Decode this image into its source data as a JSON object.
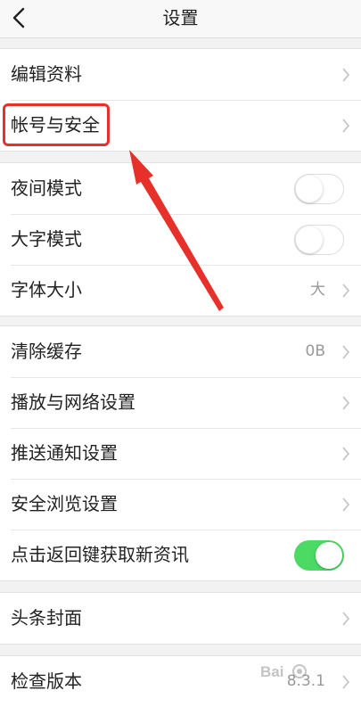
{
  "header": {
    "title": "设置",
    "back_icon": "chevron-left-icon"
  },
  "groups": [
    {
      "rows": [
        {
          "label": "编辑资料",
          "accessory": "chevron"
        },
        {
          "label": "帐号与安全",
          "accessory": "chevron",
          "highlighted": true
        }
      ]
    },
    {
      "rows": [
        {
          "label": "夜间模式",
          "accessory": "toggle",
          "toggle_on": false
        },
        {
          "label": "大字模式",
          "accessory": "toggle",
          "toggle_on": false
        },
        {
          "label": "字体大小",
          "accessory": "chevron",
          "value": "大"
        }
      ]
    },
    {
      "rows": [
        {
          "label": "清除缓存",
          "accessory": "chevron",
          "value": "0B"
        },
        {
          "label": "播放与网络设置",
          "accessory": "chevron"
        },
        {
          "label": "推送通知设置",
          "accessory": "chevron"
        },
        {
          "label": "安全浏览设置",
          "accessory": "chevron"
        },
        {
          "label": "点击返回键获取新资讯",
          "accessory": "toggle",
          "toggle_on": true
        }
      ]
    },
    {
      "rows": [
        {
          "label": "头条封面",
          "accessory": "chevron"
        }
      ]
    },
    {
      "rows": [
        {
          "label": "检查版本",
          "accessory": "chevron",
          "value": "8.3.1"
        }
      ]
    }
  ],
  "colors": {
    "toggle_on": "#4cd964",
    "annotation_red": "#e8302b",
    "background": "#f2f2f2"
  }
}
